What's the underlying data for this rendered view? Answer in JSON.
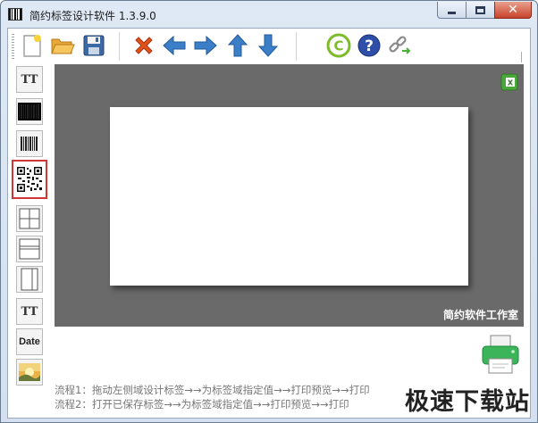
{
  "window": {
    "title": "简约标签设计软件  1.3.9.0"
  },
  "toolbar": {
    "buttons": [
      {
        "name": "new-file-icon"
      },
      {
        "name": "open-folder-icon"
      },
      {
        "name": "save-disk-icon"
      },
      {
        "name": "delete-x-icon"
      },
      {
        "name": "arrow-left-icon"
      },
      {
        "name": "arrow-right-icon"
      },
      {
        "name": "arrow-up-icon"
      },
      {
        "name": "arrow-down-icon"
      },
      {
        "name": "copyright-icon"
      },
      {
        "name": "help-icon"
      },
      {
        "name": "link-icon"
      }
    ]
  },
  "sidebar": {
    "text_tool": "TT",
    "text_tool2": "TT",
    "date_tool": "Date"
  },
  "canvas": {
    "studio": "简约软件工作室"
  },
  "flow": {
    "line1": "流程1：拖动左侧域设计标签→→为标签域指定值→→打印预览→→打印",
    "line2": "流程2：打开已保存标签→→为标签域指定值→→打印预览→→打印"
  },
  "watermark": "极速下载站",
  "colors": {
    "selected_border": "#d23535",
    "canvas_bg": "#6a6a6a",
    "delete_red": "#e0521c",
    "arrow_blue": "#3a7fc7",
    "copyright_green": "#7cbc2a",
    "help_blue": "#2d4fa8"
  }
}
